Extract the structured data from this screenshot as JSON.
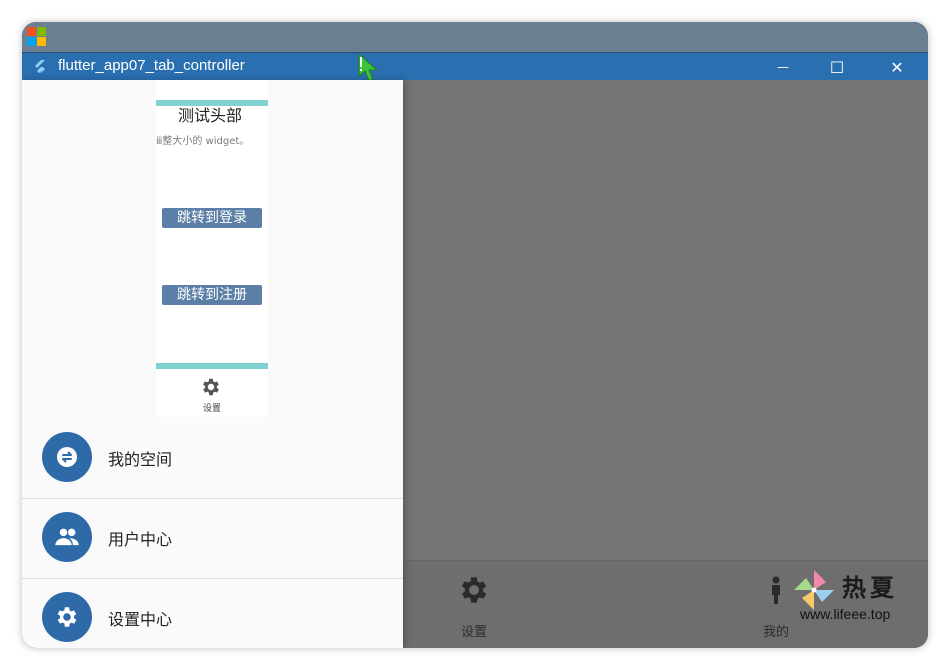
{
  "window": {
    "title": "flutter_app07_tab_controller",
    "minimize_glyph": "—",
    "maximize_glyph": "☐",
    "close_glyph": "✕"
  },
  "drawer": {
    "header": {
      "title": "测试头部",
      "subtitle": "ⅲ整大小的 widget。",
      "buttons": [
        "跳转到登录",
        "跳转到注册"
      ],
      "bottom_label": "设置"
    },
    "items": [
      {
        "label": "我的空间",
        "icon": "swap-icon"
      },
      {
        "label": "用户中心",
        "icon": "people-icon"
      },
      {
        "label": "设置中心",
        "icon": "gear-icon"
      }
    ]
  },
  "bottom_nav": {
    "items": [
      {
        "label": "设置",
        "icon": "gear-icon"
      },
      {
        "label": "我的",
        "icon": "person-icon"
      }
    ]
  },
  "watermark": {
    "title": "热夏",
    "url": "www.lifeee.top"
  },
  "colors": {
    "titlebar": "#2a6fb0",
    "avatar": "#2f6aa8",
    "accent_bar": "#7fd2cf",
    "scrim": "#747474"
  }
}
